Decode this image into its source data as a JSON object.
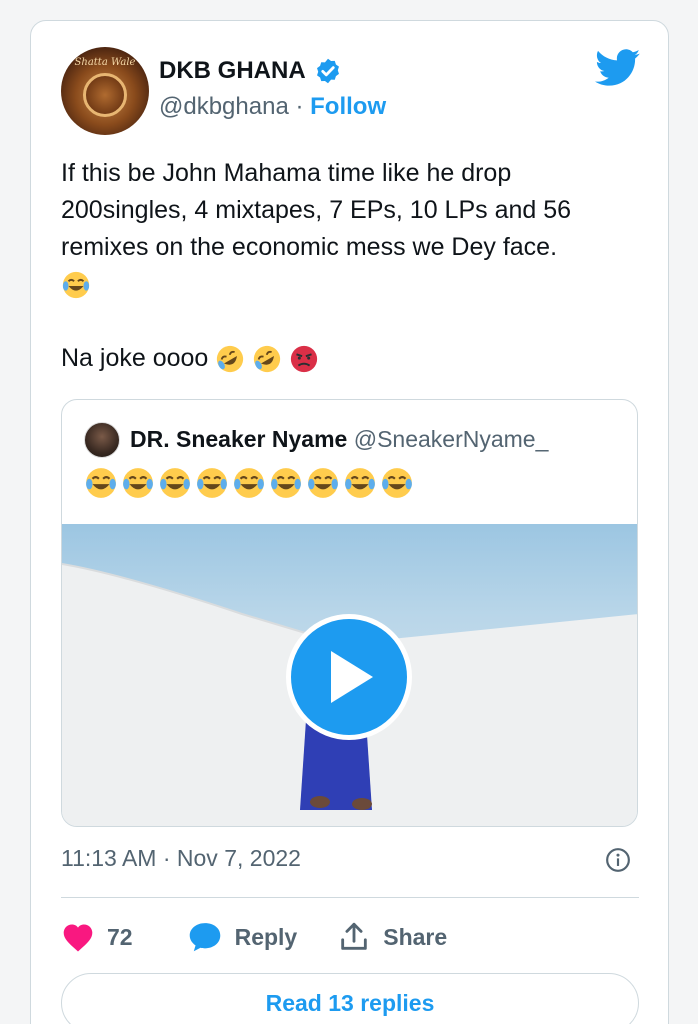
{
  "tweet": {
    "author_name": "DKB GHANA",
    "handle": "@dkbghana",
    "separator": "·",
    "follow_label": "Follow",
    "text_lines": [
      "If this be John Mahama time like he drop",
      "200singles, 4 mixtapes, 7 EPs, 10 LPs and 56",
      "remixes on the economic mess we Dey face."
    ],
    "line4_emojis": [
      "face-with-tears-of-joy"
    ],
    "line5_text": "Na joke oooo",
    "line5_emojis": [
      "rolling-on-the-floor-laughing",
      "rolling-on-the-floor-laughing",
      "pouting-face"
    ],
    "timestamp": "11:13 AM · Nov 7, 2022",
    "like_count": "72",
    "reply_label": "Reply",
    "share_label": "Share",
    "read_replies_label": "Read 13 replies",
    "avatar_signature": "Shatta Wale"
  },
  "quoted": {
    "author_name": "DR. Sneaker Nyame",
    "handle": "@SneakerNyame_",
    "emoji_count": 9,
    "emoji": "face-with-tears-of-joy"
  },
  "colors": {
    "brand_blue": "#1d9bf0",
    "heart_pink": "#f91880",
    "text_secondary": "#536471",
    "border": "#cfd9de"
  },
  "icons": [
    "twitter-bird-icon",
    "verified-badge-icon",
    "play-icon",
    "info-icon",
    "heart-icon",
    "reply-bubble-icon",
    "share-icon"
  ]
}
